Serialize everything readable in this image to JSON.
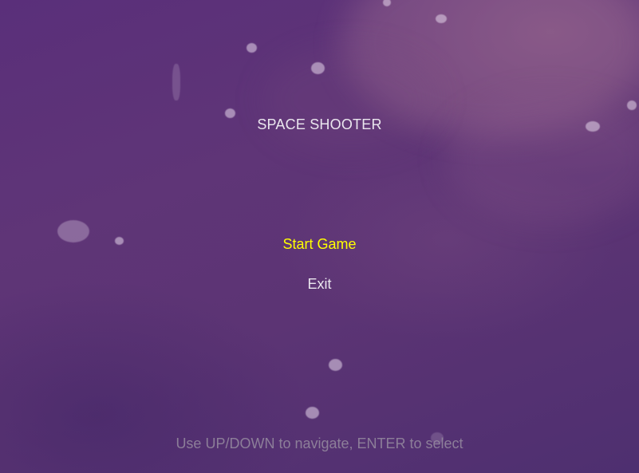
{
  "game": {
    "title": "SPACE SHOOTER",
    "menu": {
      "items": [
        {
          "label": "Start Game",
          "selected": true,
          "color": "#ffff00"
        },
        {
          "label": "Exit",
          "selected": false,
          "color": "#eae6ee"
        }
      ]
    },
    "hint": "Use UP/DOWN to navigate, ENTER to select",
    "colors": {
      "background": "#5a3276",
      "selected": "#ffff00",
      "text": "#eae6ee",
      "hint": "#968ca0"
    }
  }
}
